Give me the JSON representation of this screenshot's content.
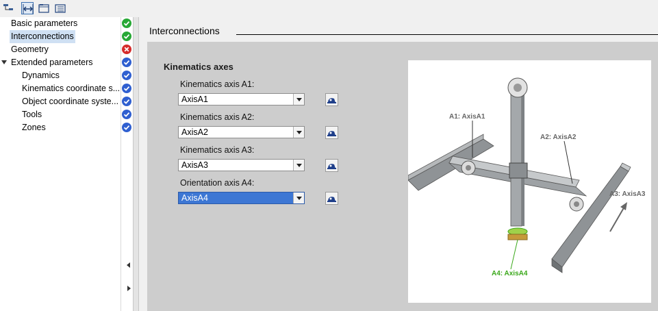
{
  "toolbar": {
    "buttons": [
      "network-view-icon",
      "splitter-toggle-icon",
      "folder-open-icon",
      "folder-tree-icon"
    ]
  },
  "tree": {
    "items": [
      {
        "label": "Basic parameters",
        "status": "ok"
      },
      {
        "label": "Interconnections",
        "status": "ok",
        "selected": true
      },
      {
        "label": "Geometry",
        "status": "error"
      },
      {
        "label": "Extended parameters",
        "status": "info",
        "expanded": true
      },
      {
        "label": "Dynamics",
        "status": "info"
      },
      {
        "label": "Kinematics coordinate s...",
        "status": "info"
      },
      {
        "label": "Object coordinate syste...",
        "status": "info"
      },
      {
        "label": "Tools",
        "status": "info"
      },
      {
        "label": "Zones",
        "status": "info"
      }
    ]
  },
  "main": {
    "title": "Interconnections",
    "section_title": "Kinematics axes",
    "fields": [
      {
        "label": "Kinematics axis A1:",
        "value": "AxisA1"
      },
      {
        "label": "Kinematics axis A2:",
        "value": "AxisA2"
      },
      {
        "label": "Kinematics axis A3:",
        "value": "AxisA3"
      },
      {
        "label": "Orientation axis A4:",
        "value": "AxisA4",
        "highlighted": true
      }
    ]
  },
  "illustration": {
    "labels": {
      "a1": "A1: AxisA1",
      "a2": "A2: AxisA2",
      "a3": "A3: AxisA3",
      "a4": "A4: AxisA4"
    }
  },
  "colors": {
    "status_ok": "#27a835",
    "status_error": "#d52b2b",
    "status_info": "#2f5fd0",
    "selection": "#3d77d4",
    "axis_a4": "#3aa81a"
  }
}
